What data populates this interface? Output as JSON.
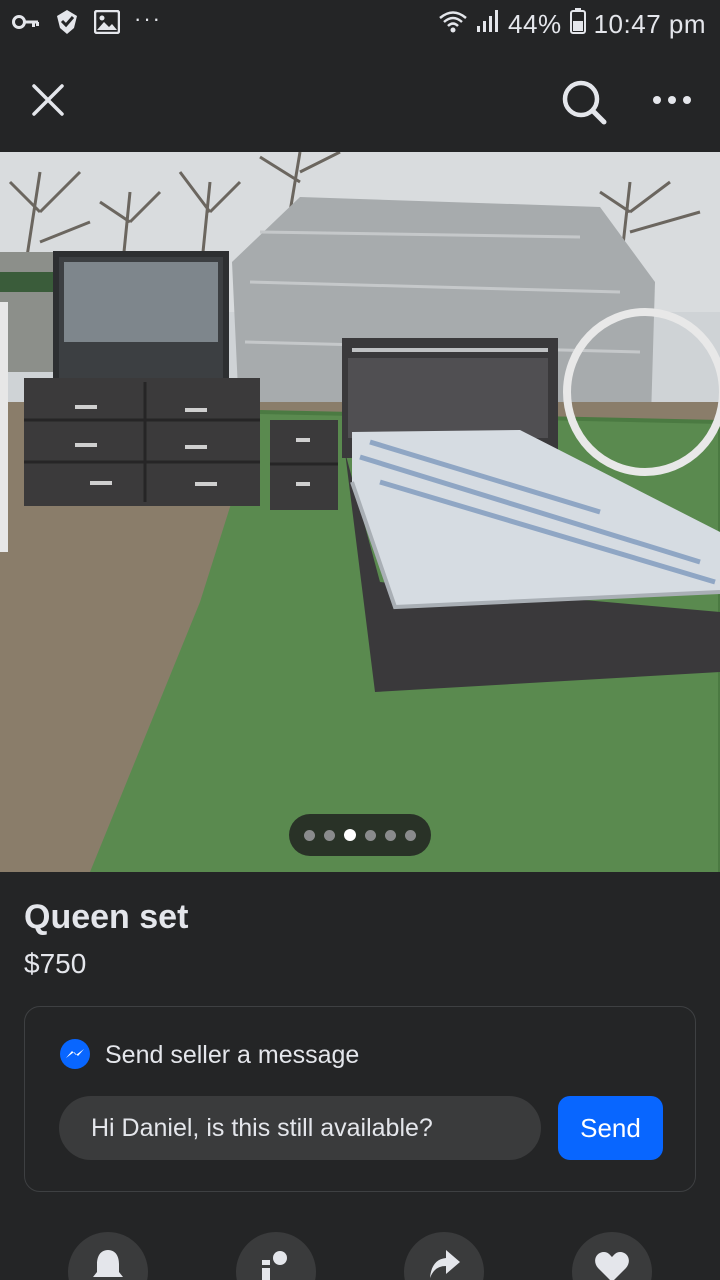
{
  "status_bar": {
    "battery": "44%",
    "time": "10:47 pm",
    "overflow": "···",
    "icons": [
      "key-icon",
      "check-shield-icon",
      "image-icon",
      "wifi-icon",
      "signal-icon",
      "battery-icon"
    ]
  },
  "header": {
    "icons": [
      "close-icon",
      "search-icon",
      "more-icon"
    ]
  },
  "photo": {
    "page_count": 6,
    "active_page": 3
  },
  "listing": {
    "title": "Queen set",
    "price": "$750"
  },
  "message": {
    "header_label": "Send seller a message",
    "input_value": "Hi Daniel, is this still available?",
    "send_label": "Send",
    "icon": "messenger-icon"
  },
  "actions": {
    "icons": [
      "bell-icon",
      "person-info-icon",
      "share-icon",
      "heart-icon"
    ]
  },
  "colors": {
    "background": "#242526",
    "card_border": "#3e4042",
    "input_bg": "#3a3b3c",
    "accent": "#0866ff",
    "text": "#e4e6eb"
  }
}
